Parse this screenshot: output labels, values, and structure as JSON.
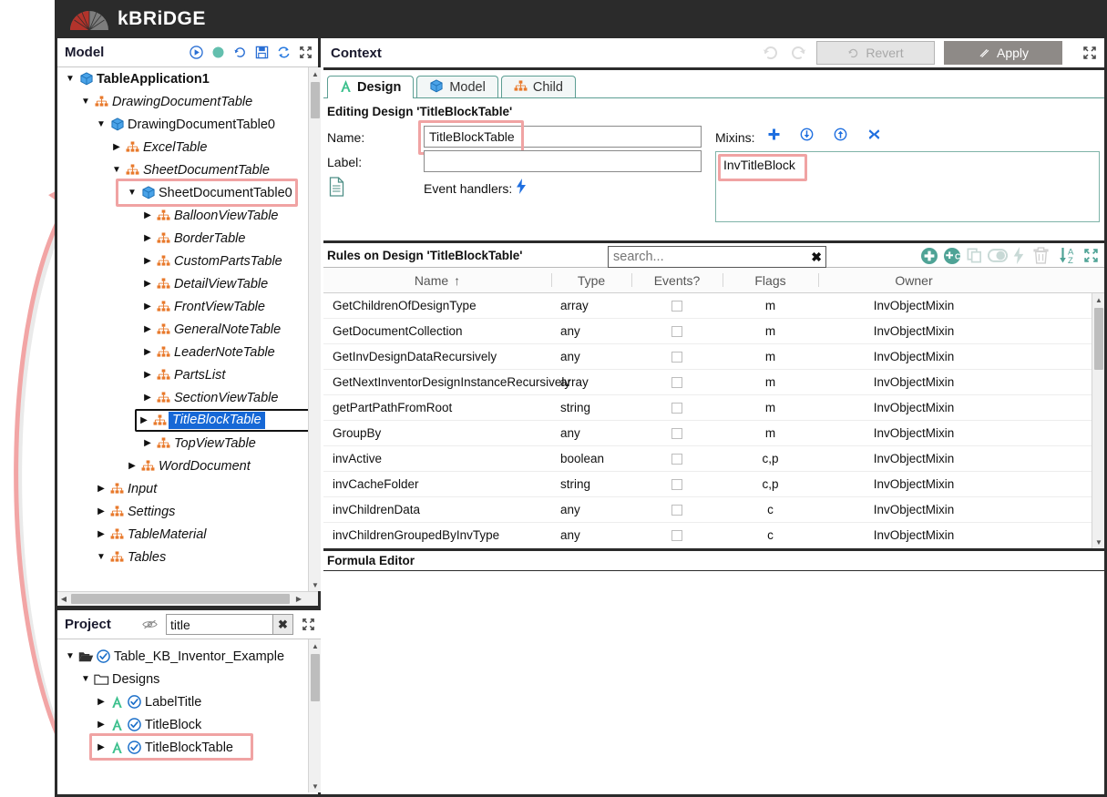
{
  "app": {
    "logo_text": "kBRiDGE"
  },
  "model_panel": {
    "title": "Model",
    "tools": [
      {
        "name": "run-icon",
        "glyph": "▶"
      },
      {
        "name": "status-dot-icon",
        "glyph": "●"
      },
      {
        "name": "history-icon",
        "glyph": "↺"
      },
      {
        "name": "save-icon",
        "glyph": "💾"
      },
      {
        "name": "refresh-icon",
        "glyph": "↻"
      },
      {
        "name": "expand-icon",
        "glyph": "⬌"
      }
    ],
    "tree": [
      {
        "label": "TableApplication1",
        "depth": 0,
        "caret": "down",
        "icon": "cube",
        "style": "bold"
      },
      {
        "label": "DrawingDocumentTable",
        "depth": 1,
        "caret": "down",
        "icon": "org",
        "style": "italic"
      },
      {
        "label": "DrawingDocumentTable0",
        "depth": 2,
        "caret": "down",
        "icon": "cube",
        "style": "plain"
      },
      {
        "label": "ExcelTable",
        "depth": 3,
        "caret": "right",
        "icon": "org",
        "style": "italic"
      },
      {
        "label": "SheetDocumentTable",
        "depth": 3,
        "caret": "down",
        "icon": "org",
        "style": "italic"
      },
      {
        "label": "SheetDocumentTable0",
        "depth": 4,
        "caret": "down",
        "icon": "cube",
        "style": "plain",
        "highlight": true
      },
      {
        "label": "BalloonViewTable",
        "depth": 5,
        "caret": "right",
        "icon": "org",
        "style": "italic"
      },
      {
        "label": "BorderTable",
        "depth": 5,
        "caret": "right",
        "icon": "org",
        "style": "italic"
      },
      {
        "label": "CustomPartsTable",
        "depth": 5,
        "caret": "right",
        "icon": "org",
        "style": "italic"
      },
      {
        "label": "DetailViewTable",
        "depth": 5,
        "caret": "right",
        "icon": "org",
        "style": "italic"
      },
      {
        "label": "FrontViewTable",
        "depth": 5,
        "caret": "right",
        "icon": "org",
        "style": "italic"
      },
      {
        "label": "GeneralNoteTable",
        "depth": 5,
        "caret": "right",
        "icon": "org",
        "style": "italic"
      },
      {
        "label": "LeaderNoteTable",
        "depth": 5,
        "caret": "right",
        "icon": "org",
        "style": "italic"
      },
      {
        "label": "PartsList",
        "depth": 5,
        "caret": "right",
        "icon": "org",
        "style": "italic"
      },
      {
        "label": "SectionViewTable",
        "depth": 5,
        "caret": "right",
        "icon": "org",
        "style": "italic"
      },
      {
        "label": "TitleBlockTable",
        "depth": 5,
        "caret": "right",
        "icon": "org",
        "style": "italic",
        "selected": true
      },
      {
        "label": "TopViewTable",
        "depth": 5,
        "caret": "right",
        "icon": "org",
        "style": "italic"
      },
      {
        "label": "WordDocument",
        "depth": 4,
        "caret": "right",
        "icon": "org",
        "style": "italic"
      },
      {
        "label": "Input",
        "depth": 2,
        "caret": "right",
        "icon": "org",
        "style": "italic"
      },
      {
        "label": "Settings",
        "depth": 2,
        "caret": "right",
        "icon": "org",
        "style": "italic"
      },
      {
        "label": "TableMaterial",
        "depth": 2,
        "caret": "right",
        "icon": "org",
        "style": "italic"
      },
      {
        "label": "Tables",
        "depth": 2,
        "caret": "down",
        "icon": "org",
        "style": "italic"
      }
    ]
  },
  "project_panel": {
    "title": "Project",
    "eye_icon": "hide-icon",
    "search_value": "title",
    "search_placeholder": "",
    "clear_label": "✖",
    "expand_icon": "expand-icon",
    "tree": [
      {
        "label": "Table_KB_Inventor_Example",
        "depth": 0,
        "caret": "down",
        "icon": "folder-open",
        "check": true
      },
      {
        "label": "Designs",
        "depth": 1,
        "caret": "down",
        "icon": "folder",
        "check": false
      },
      {
        "label": "LabelTitle",
        "depth": 2,
        "caret": "right",
        "icon": "design-a",
        "check": true
      },
      {
        "label": "TitleBlock",
        "depth": 2,
        "caret": "right",
        "icon": "design-a",
        "check": true
      },
      {
        "label": "TitleBlockTable",
        "depth": 2,
        "caret": "right",
        "icon": "design-a",
        "check": true,
        "highlight": true
      }
    ]
  },
  "context": {
    "title": "Context",
    "undo_icon": "undo-icon",
    "redo_icon": "redo-icon",
    "revert_label": "Revert",
    "apply_label": "Apply",
    "expand_icon": "expand-icon",
    "tabs": [
      {
        "label": "Design",
        "icon": "design-a-icon",
        "active": true
      },
      {
        "label": "Model",
        "icon": "cube-icon",
        "active": false
      },
      {
        "label": "Child",
        "icon": "org-icon",
        "active": false
      }
    ],
    "editing_line": "Editing Design 'TitleBlockTable'",
    "form": {
      "name_label": "Name:",
      "name_value": "TitleBlockTable",
      "label_label": "Label:",
      "label_value": "",
      "doc_icon": "document-icon",
      "event_handlers_label": "Event handlers:",
      "event_handlers_icon": "lightning-icon",
      "mixins_label": "Mixins:",
      "mixins_tools": [
        {
          "name": "add-mixin-icon",
          "glyph": "✚"
        },
        {
          "name": "move-down-icon",
          "glyph": "↓"
        },
        {
          "name": "move-up-icon",
          "glyph": "↑"
        },
        {
          "name": "remove-mixin-icon",
          "glyph": "✖"
        }
      ],
      "mixins_items": [
        "InvTitleBlock"
      ]
    }
  },
  "rules": {
    "title": "Rules on Design 'TitleBlockTable'",
    "search_placeholder": "search...",
    "search_value": "",
    "search_clear": "✖",
    "tools": [
      {
        "name": "add-rule-icon",
        "glyph": "+"
      },
      {
        "name": "add-child-rule-icon",
        "glyph": "+C"
      },
      {
        "name": "copy-rule-icon",
        "glyph": "copy"
      },
      {
        "name": "toggle-rule-icon",
        "glyph": "toggle"
      },
      {
        "name": "event-rule-icon",
        "glyph": "bolt"
      },
      {
        "name": "delete-rule-icon",
        "glyph": "trash"
      },
      {
        "name": "sort-az-icon",
        "glyph": "AZ"
      },
      {
        "name": "expand-icon",
        "glyph": "expand"
      }
    ],
    "columns": [
      {
        "label": "Name",
        "sort": "↑"
      },
      {
        "label": "Type",
        "sort": ""
      },
      {
        "label": "Events?",
        "sort": ""
      },
      {
        "label": "Flags",
        "sort": ""
      },
      {
        "label": "Owner",
        "sort": ""
      }
    ],
    "rows": [
      {
        "name": "GetChildrenOfDesignType",
        "type": "array",
        "events": false,
        "flags": "m",
        "owner": "InvObjectMixin"
      },
      {
        "name": "GetDocumentCollection",
        "type": "any",
        "events": false,
        "flags": "m",
        "owner": "InvObjectMixin"
      },
      {
        "name": "GetInvDesignDataRecursively",
        "type": "any",
        "events": false,
        "flags": "m",
        "owner": "InvObjectMixin"
      },
      {
        "name": "GetNextInventorDesignInstanceRecursively",
        "type": "array",
        "events": false,
        "flags": "m",
        "owner": "InvObjectMixin"
      },
      {
        "name": "getPartPathFromRoot",
        "type": "string",
        "events": false,
        "flags": "m",
        "owner": "InvObjectMixin"
      },
      {
        "name": "GroupBy",
        "type": "any",
        "events": false,
        "flags": "m",
        "owner": "InvObjectMixin"
      },
      {
        "name": "invActive",
        "type": "boolean",
        "events": false,
        "flags": "c,p",
        "owner": "InvObjectMixin"
      },
      {
        "name": "invCacheFolder",
        "type": "string",
        "events": false,
        "flags": "c,p",
        "owner": "InvObjectMixin"
      },
      {
        "name": "invChildrenData",
        "type": "any",
        "events": false,
        "flags": "c",
        "owner": "InvObjectMixin"
      },
      {
        "name": "invChildrenGroupedByInvType",
        "type": "any",
        "events": false,
        "flags": "c",
        "owner": "InvObjectMixin"
      }
    ]
  },
  "formula_editor": {
    "title": "Formula Editor",
    "content": ""
  },
  "colors": {
    "accent_teal": "#4fa396",
    "highlight_pink": "#f0a3a3",
    "selection_blue": "#1668d6",
    "tree_icon_orange": "#e8792b",
    "titlebar": "#2b2b2b"
  }
}
